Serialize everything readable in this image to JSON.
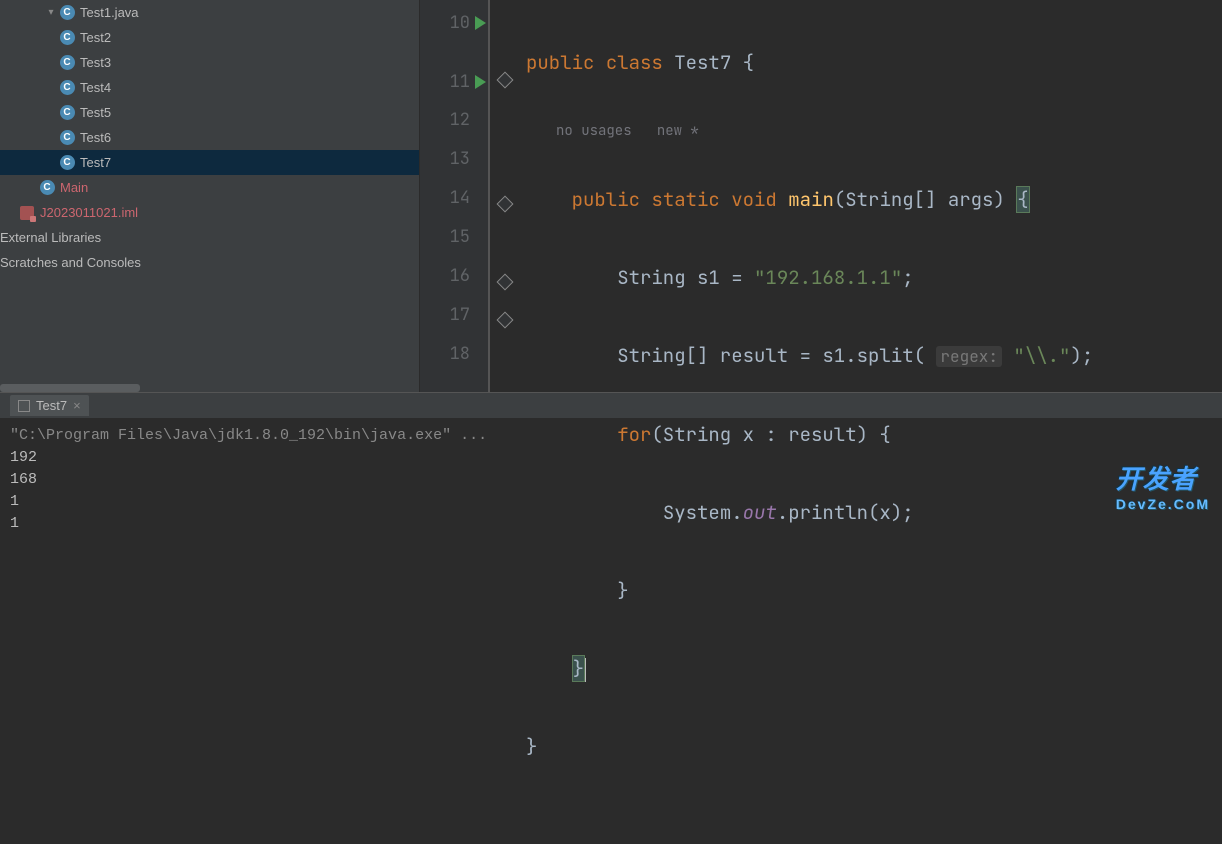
{
  "sidebar": {
    "items": [
      {
        "label": "Test1.java",
        "depth": 3,
        "expanded": true,
        "selected": false,
        "icon": "c",
        "arrow": true
      },
      {
        "label": "Test2",
        "depth": 3,
        "icon": "c"
      },
      {
        "label": "Test3",
        "depth": 3,
        "icon": "c"
      },
      {
        "label": "Test4",
        "depth": 3,
        "icon": "c"
      },
      {
        "label": "Test5",
        "depth": 3,
        "icon": "c"
      },
      {
        "label": "Test6",
        "depth": 3,
        "icon": "c"
      },
      {
        "label": "Test7",
        "depth": 3,
        "icon": "c",
        "selected": true
      },
      {
        "label": "Main",
        "depth": 2,
        "icon": "c",
        "red": true
      },
      {
        "label": "J2023011021.iml",
        "depth": 1,
        "icon": "iml",
        "red": true
      }
    ],
    "footer": [
      "External Libraries",
      "Scratches and Consoles"
    ]
  },
  "editor": {
    "line_numbers": [
      "10",
      "11",
      "12",
      "13",
      "14",
      "15",
      "16",
      "17",
      "18"
    ],
    "run_markers": [
      10,
      11
    ],
    "usages_text": "no usages",
    "new_text": "new *",
    "code": {
      "l10": {
        "kw1": "public",
        "kw2": "class",
        "name": "Test7",
        "brace": "{"
      },
      "l11": {
        "kw1": "public",
        "kw2": "static",
        "kw3": "void",
        "meth": "main",
        "params": "(String[] args)",
        "brace": "{"
      },
      "l12": {
        "text1": "String s1 = ",
        "str": "\"192.168.1.1\"",
        "semi": ";"
      },
      "l13": {
        "text1": "String[] result = s1.split( ",
        "hint": "regex:",
        "str": "\"\\\\.\"",
        "tail": ");"
      },
      "l14": {
        "kw": "for",
        "text": "(String x : result) {"
      },
      "l15": {
        "text1": "System.",
        "ital": "out",
        "text2": ".println(x);"
      },
      "l16": {
        "brace": "}"
      },
      "l17": {
        "brace": "}"
      },
      "l18": {
        "brace": "}"
      }
    }
  },
  "console": {
    "tab": "Test7",
    "command": "\"C:\\Program Files\\Java\\jdk1.8.0_192\\bin\\java.exe\" ...",
    "output": [
      "192",
      "168",
      "1",
      "1"
    ]
  },
  "watermark": {
    "main": "开发者",
    "sub": "DevZe.CoM"
  }
}
